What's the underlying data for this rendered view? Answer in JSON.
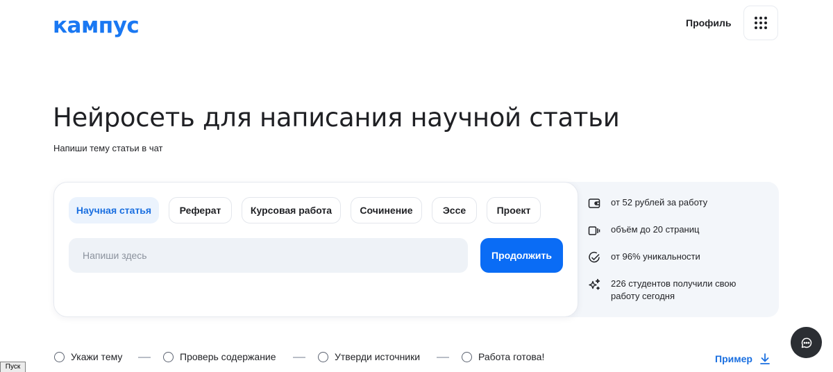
{
  "header": {
    "logo": "кампус",
    "profile_label": "Профиль",
    "menu_icon": "grid-menu-icon"
  },
  "hero": {
    "title": "Нейросеть для написания научной статьи",
    "subtitle": "Напиши тему статьи в чат"
  },
  "work_types": [
    {
      "label": "Научная статья",
      "selected": true
    },
    {
      "label": "Реферат",
      "selected": false
    },
    {
      "label": "Курсовая работа",
      "selected": false
    },
    {
      "label": "Сочинение",
      "selected": false
    },
    {
      "label": "Эссе",
      "selected": false
    },
    {
      "label": "Проект",
      "selected": false
    }
  ],
  "input": {
    "placeholder": "Напиши здесь",
    "value": ""
  },
  "continue_label": "Продолжить",
  "features": [
    {
      "icon": "wallet-icon",
      "text": "от 52 рублей за работу"
    },
    {
      "icon": "pages-icon",
      "text": "объём до 20 страниц"
    },
    {
      "icon": "check-circle-icon",
      "text": "от 96% уникальности"
    },
    {
      "icon": "sparkle-icon",
      "text": "226 студентов получили свою работу сегодня"
    }
  ],
  "steps": [
    {
      "label": "Укажи тему"
    },
    {
      "label": "Проверь содержание"
    },
    {
      "label": "Утверди источники"
    },
    {
      "label": "Работа готова!"
    }
  ],
  "example_label": "Пример",
  "chat_icon": "chat-bubble-icon",
  "taskbar": {
    "start_label": "Пуск"
  },
  "colors": {
    "brand": "#1a78f2",
    "primary_button": "#0a6cf5",
    "selected_chip_bg": "#ebf3fd",
    "info_panel_bg": "#f3f6fa",
    "chat_button": "#2b2e33"
  }
}
